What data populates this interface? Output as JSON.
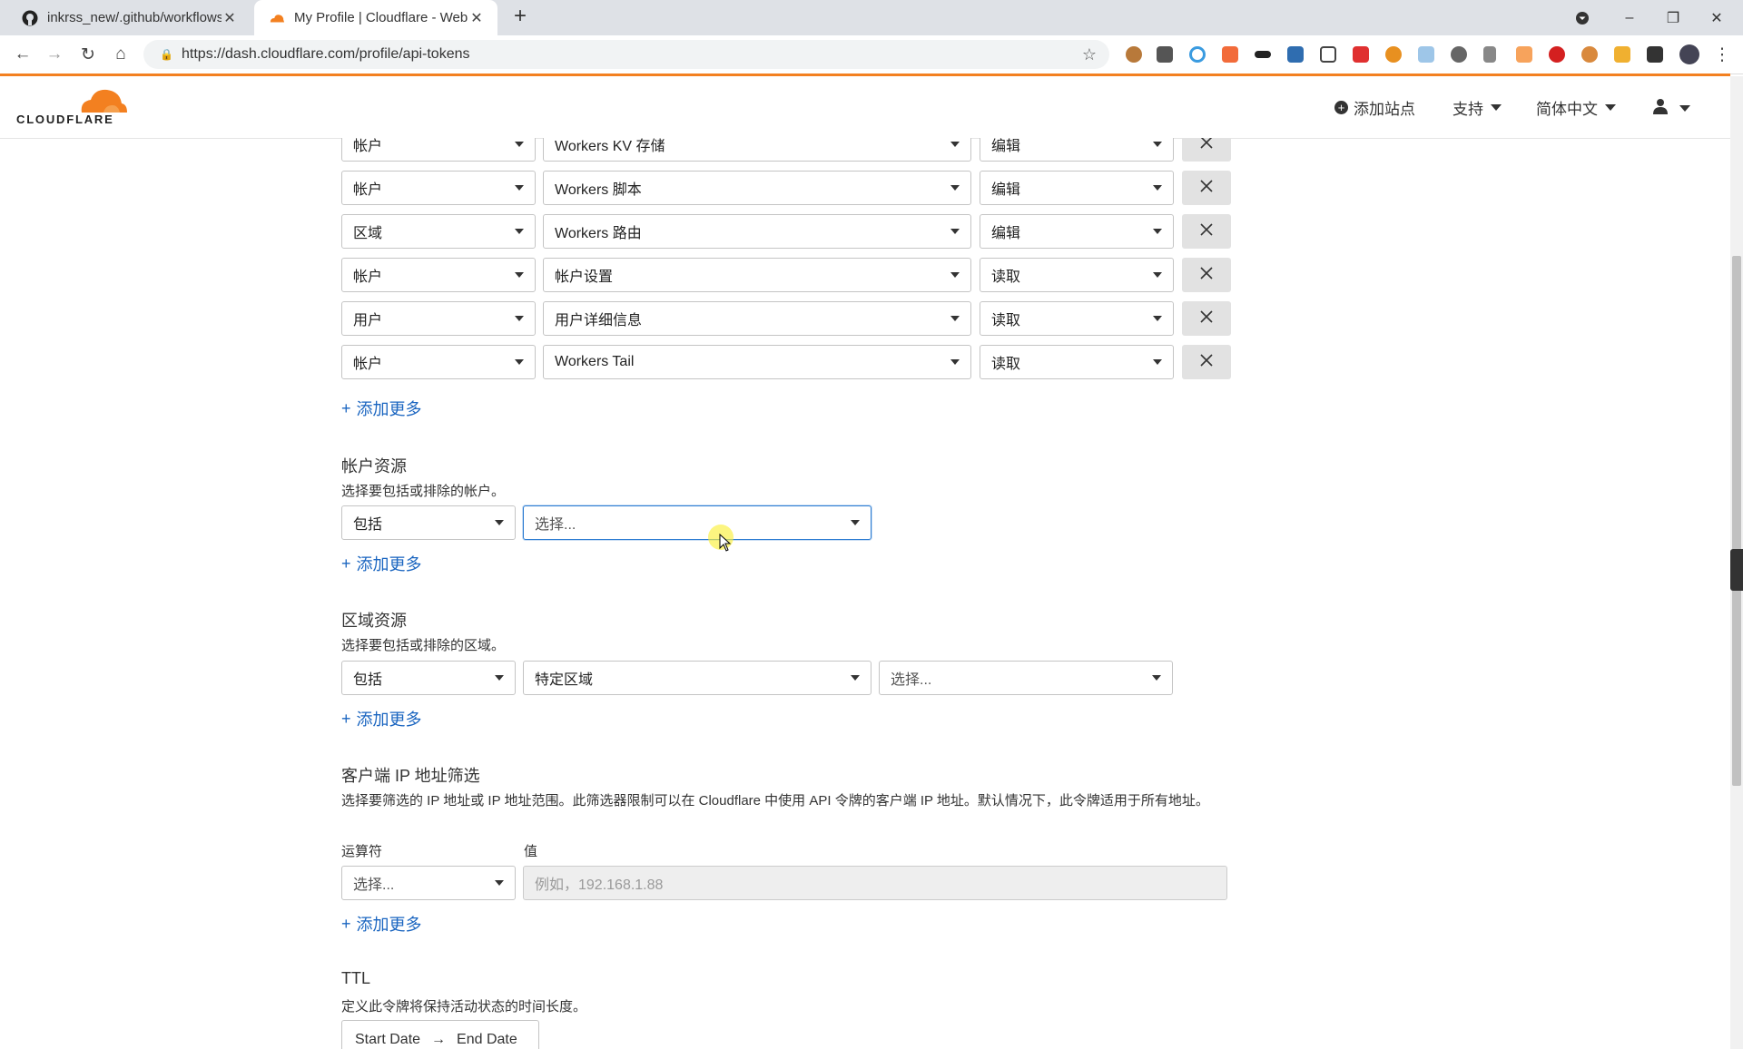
{
  "browser": {
    "tabs": [
      {
        "title": "inkrss_new/.github/workflows",
        "icon": "github-icon"
      },
      {
        "title": "My Profile | Cloudflare - Web P",
        "icon": "cloudflare-icon"
      }
    ],
    "url": "https://dash.cloudflare.com/profile/api-tokens"
  },
  "header": {
    "logo_text": "CLOUDFLARE",
    "add_site": "添加站点",
    "support": "支持",
    "language": "简体中文",
    "colors": {
      "brand": "#f38020",
      "link": "#1a65c0"
    }
  },
  "permissions": {
    "rows": [
      {
        "scope": "帐户",
        "resource": "Workers KV 存储",
        "access": "编辑"
      },
      {
        "scope": "帐户",
        "resource": "Workers 脚本",
        "access": "编辑"
      },
      {
        "scope": "区域",
        "resource": "Workers 路由",
        "access": "编辑"
      },
      {
        "scope": "帐户",
        "resource": "帐户设置",
        "access": "读取"
      },
      {
        "scope": "用户",
        "resource": "用户详细信息",
        "access": "读取"
      },
      {
        "scope": "帐户",
        "resource": "Workers Tail",
        "access": "读取"
      }
    ],
    "add_more": "添加更多"
  },
  "account_resources": {
    "title": "帐户资源",
    "description": "选择要包括或排除的帐户。",
    "include": "包括",
    "select_placeholder": "选择...",
    "add_more": "添加更多"
  },
  "zone_resources": {
    "title": "区域资源",
    "description": "选择要包括或排除的区域。",
    "include": "包括",
    "zone_type": "特定区域",
    "select_placeholder": "选择...",
    "add_more": "添加更多"
  },
  "ip_filter": {
    "title": "客户端 IP 地址筛选",
    "description": "选择要筛选的 IP 地址或 IP 地址范围。此筛选器限制可以在 Cloudflare 中使用 API 令牌的客户端 IP 地址。默认情况下，此令牌适用于所有地址。",
    "operator_label": "运算符",
    "value_label": "值",
    "operator_placeholder": "选择...",
    "value_placeholder": "例如，192.168.1.88",
    "add_more": "添加更多"
  },
  "ttl": {
    "title": "TTL",
    "description": "定义此令牌将保持活动状态的时间长度。",
    "start": "Start Date",
    "arrow": "→",
    "end": "End Date"
  }
}
